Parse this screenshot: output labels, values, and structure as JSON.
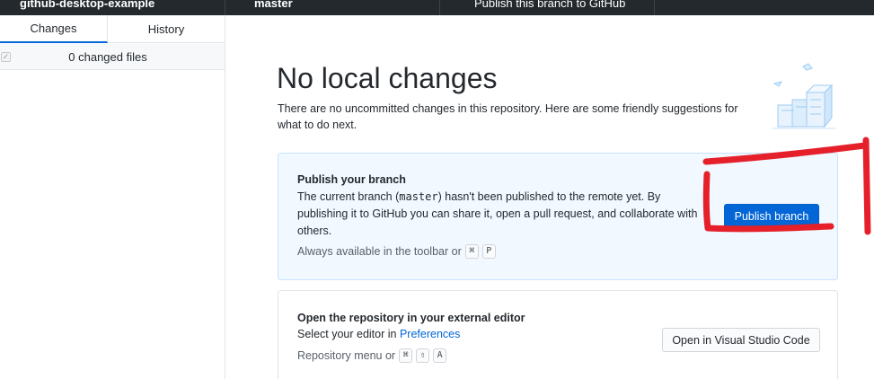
{
  "toolbar": {
    "repository": "github-desktop-example",
    "branch": "master",
    "publish_action": "Publish this branch to GitHub"
  },
  "sidebar": {
    "tabs": [
      {
        "label": "Changes",
        "selected": true
      },
      {
        "label": "History",
        "selected": false
      }
    ],
    "changes_summary": "0 changed files",
    "checkbox_glyph": "✓"
  },
  "main": {
    "title": "No local changes",
    "subtitle": "There are no uncommitted changes in this repository. Here are some friendly suggestions for what to do next.",
    "publish_card": {
      "title": "Publish your branch",
      "body_before": "The current branch (",
      "branch_name": "master",
      "body_after": ") hasn't been published to the remote yet. By publishing it to GitHub you can share it, open a pull request, and collaborate with others.",
      "hint_text": "Always available in the toolbar or",
      "shortcut_keys": [
        "⌘",
        "P"
      ],
      "button_label": "Publish branch"
    },
    "editor_card": {
      "title": "Open the repository in your external editor",
      "body_prefix": "Select your editor in",
      "body_link": "Preferences",
      "hint_text": "Repository menu or",
      "shortcut_keys": [
        "⌘",
        "⇧",
        "A"
      ],
      "button_label": "Open in Visual Studio Code"
    }
  },
  "colors": {
    "toolbar_bg": "#24292e",
    "accent": "#0366d6",
    "publish_card_bg": "#f1f8ff",
    "annotation_red": "#e5202a"
  }
}
